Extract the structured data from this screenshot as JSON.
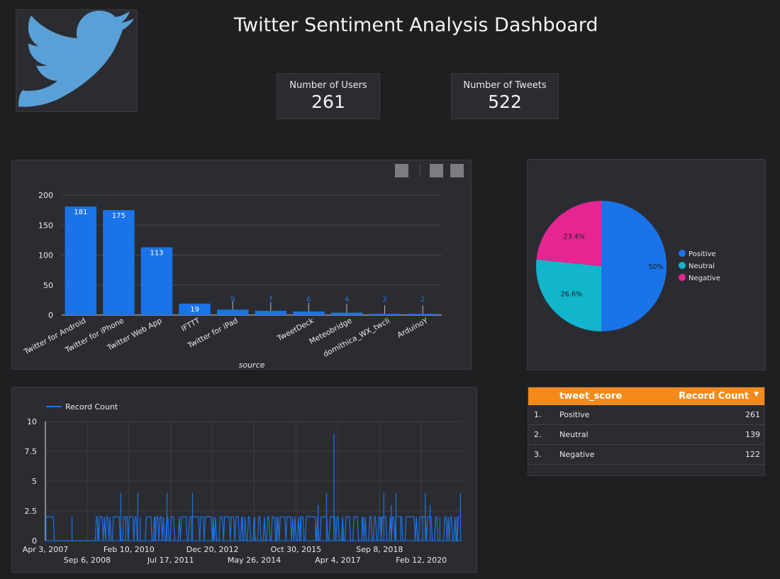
{
  "dashboard": {
    "title": "Twitter Sentiment Analysis Dashboard",
    "logo": "twitter-bird-icon"
  },
  "kpis": [
    {
      "label": "Number of Users",
      "value": "261"
    },
    {
      "label": "Number of Tweets",
      "value": "522"
    }
  ],
  "colors": {
    "background": "#1e1f21",
    "card": "#2b2c31",
    "bar": "#1a73e8",
    "positive": "#1a73e8",
    "neutral": "#12b5cb",
    "negative": "#e52592",
    "table_header": "#f28b1b",
    "logo": "#5aa0d8"
  },
  "chart_data": [
    {
      "type": "bar",
      "xlabel": "source",
      "ylabel": "",
      "ylim": [
        0,
        200
      ],
      "yticks": [
        "0",
        "50",
        "100",
        "150",
        "200"
      ],
      "categories": [
        "Twitter for Android",
        "Twitter for iPhone",
        "Twitter Web App",
        "IFTTT",
        "Twitter for iPad",
        "",
        "TweetDeck",
        "Meteobridge",
        "domithica_WX_twcli",
        "ArduinoY"
      ],
      "values": [
        181,
        175,
        113,
        19,
        9,
        7,
        6,
        4,
        2,
        2
      ],
      "value_labels": [
        "181",
        "175",
        "113",
        "19",
        "9",
        "7",
        "6",
        "4",
        "2",
        "2"
      ],
      "grid": true
    },
    {
      "type": "pie",
      "labels": [
        "Positive",
        "Neutral",
        "Negative"
      ],
      "values": [
        50,
        26.6,
        23.4
      ],
      "value_labels": [
        "50%",
        "26.6%",
        "23.4%"
      ],
      "legend": "right"
    },
    {
      "type": "line",
      "series": [
        {
          "name": "Record Count"
        }
      ],
      "ylim": [
        0,
        10
      ],
      "yticks": [
        "0",
        "2.5",
        "5",
        "7.5",
        "10"
      ],
      "xticks_top": [
        "Apr 3, 2007",
        "Feb 10, 2010",
        "Dec 20, 2012",
        "Oct 30, 2015",
        "Sep 8, 2018"
      ],
      "xticks_bottom": [
        "Sep 6, 2008",
        "Jul 17, 2011",
        "May 26, 2014",
        "Apr 4, 2017",
        "Feb 12, 2020"
      ],
      "xlim": [
        "2007-04-03",
        "2021-06-30"
      ],
      "spikes": [
        [
          "2007-04-10",
          2
        ],
        [
          "2008-03-01",
          2
        ],
        [
          "2009-01-15",
          2
        ],
        [
          "2010-01-01",
          2
        ],
        [
          "2010-07-01",
          2
        ],
        [
          "2011-01-01",
          2
        ],
        [
          "2012-04-01",
          2
        ],
        [
          "2013-01-01",
          2
        ],
        [
          "2014-01-01",
          2
        ],
        [
          "2014-06-01",
          2
        ],
        [
          "2015-03-01",
          2
        ],
        [
          "2016-01-01",
          2
        ],
        [
          "2016-07-01",
          2
        ],
        [
          "2017-06-01",
          2
        ],
        [
          "2017-06-01",
          2
        ],
        [
          "2018-02-01",
          2
        ],
        [
          "2018-10-01",
          2
        ],
        [
          "2019-06-01",
          2
        ],
        [
          "2020-03-01",
          2
        ],
        [
          "2020-10-01",
          2
        ],
        [
          "2021-05-01",
          2
        ],
        [
          "2009-11-01",
          4
        ],
        [
          "2010-06-01",
          4
        ],
        [
          "2011-06-01",
          4
        ],
        [
          "2012-04-15",
          4
        ],
        [
          "2016-11-15",
          4
        ],
        [
          "2018-11-01",
          4
        ],
        [
          "2019-04-01",
          4
        ],
        [
          "2020-04-01",
          4
        ],
        [
          "2021-06-15",
          4
        ],
        [
          "2016-08-01",
          3
        ],
        [
          "2019-02-01",
          3
        ],
        [
          "2020-06-01",
          3
        ],
        [
          "2017-02-15",
          9
        ]
      ]
    }
  ],
  "table": {
    "headers": [
      "tweet_score",
      "Record Count"
    ],
    "sort_icon": "sort-desc-icon",
    "rows": [
      {
        "num": "1.",
        "label": "Positive",
        "value": "261"
      },
      {
        "num": "2.",
        "label": "Neutral",
        "value": "139"
      },
      {
        "num": "3.",
        "label": "Negative",
        "value": "122"
      }
    ]
  }
}
